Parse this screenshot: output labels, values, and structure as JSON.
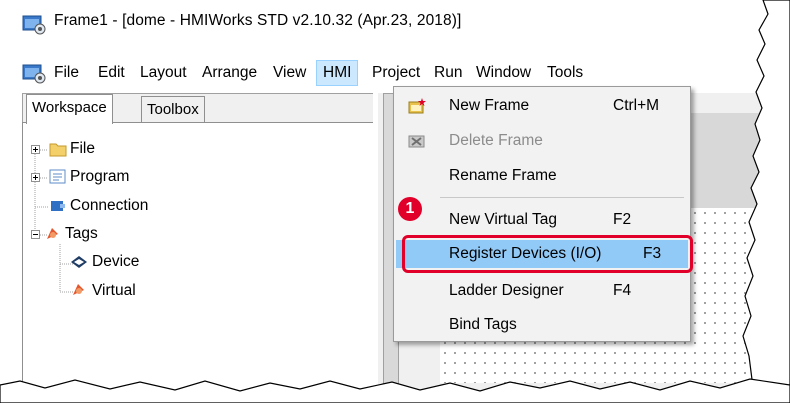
{
  "window": {
    "title": "Frame1 - [dome - HMIWorks STD v2.10.32 (Apr.23, 2018)]"
  },
  "menubar": {
    "items": [
      "File",
      "Edit",
      "Layout",
      "Arrange",
      "View",
      "HMI",
      "Project",
      "Run",
      "Window",
      "Tools"
    ],
    "active": "HMI"
  },
  "workspace": {
    "tabs": [
      "Workspace",
      "Toolbox"
    ],
    "selected_tab": "Workspace",
    "tree": [
      {
        "label": "File",
        "icon": "folder-icon",
        "expander": "+"
      },
      {
        "label": "Program",
        "icon": "program-icon",
        "expander": "+"
      },
      {
        "label": "Connection",
        "icon": "connection-icon"
      },
      {
        "label": "Tags",
        "icon": "tags-icon",
        "expander": "-"
      },
      {
        "label": "Device",
        "icon": "device-icon"
      },
      {
        "label": "Virtual",
        "icon": "virtual-icon"
      }
    ]
  },
  "hmi_menu": {
    "items": [
      {
        "label": "New Frame",
        "shortcut": "Ctrl+M",
        "icon": "new-frame-icon",
        "enabled": true
      },
      {
        "label": "Delete Frame",
        "shortcut": "",
        "icon": "delete-frame-icon",
        "enabled": false
      },
      {
        "label": "Rename Frame",
        "shortcut": "",
        "enabled": true
      },
      {
        "label": "New Virtual Tag",
        "shortcut": "F2",
        "enabled": true
      },
      {
        "label": "Register Devices (I/O)",
        "shortcut": "F3",
        "enabled": true,
        "highlighted": true
      },
      {
        "label": "Ladder Designer",
        "shortcut": "F4",
        "enabled": true
      },
      {
        "label": "Bind Tags",
        "shortcut": "",
        "enabled": true
      }
    ]
  },
  "annotation": {
    "badge": "1",
    "color": "#e0002a"
  },
  "colors": {
    "menu_highlight": "#91c9f7",
    "active_menu": "#cce8ff"
  }
}
